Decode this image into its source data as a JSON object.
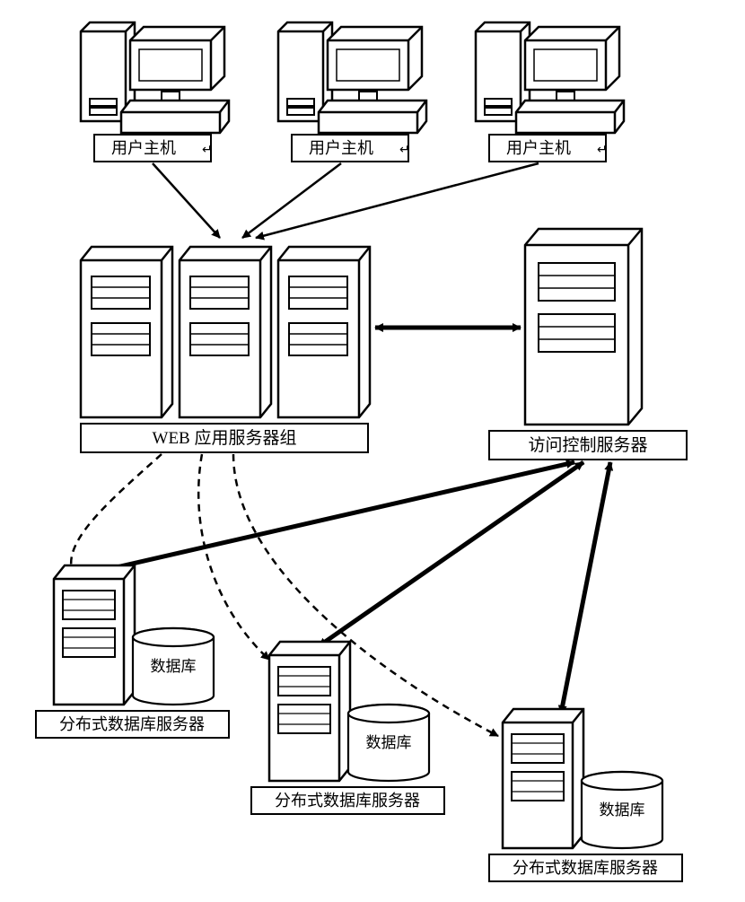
{
  "labels": {
    "user_host_1": "用户主机",
    "user_host_2": "用户主机",
    "user_host_3": "用户主机",
    "web_server_group": "WEB 应用服务器组",
    "access_control_server": "访问控制服务器",
    "dist_db_server_1": "分布式数据库服务器",
    "dist_db_server_2": "分布式数据库服务器",
    "dist_db_server_3": "分布式数据库服务器",
    "database_1": "数据库",
    "database_2": "数据库",
    "database_3": "数据库",
    "enter_1": "↵",
    "enter_2": "↵",
    "enter_3": "↵"
  }
}
